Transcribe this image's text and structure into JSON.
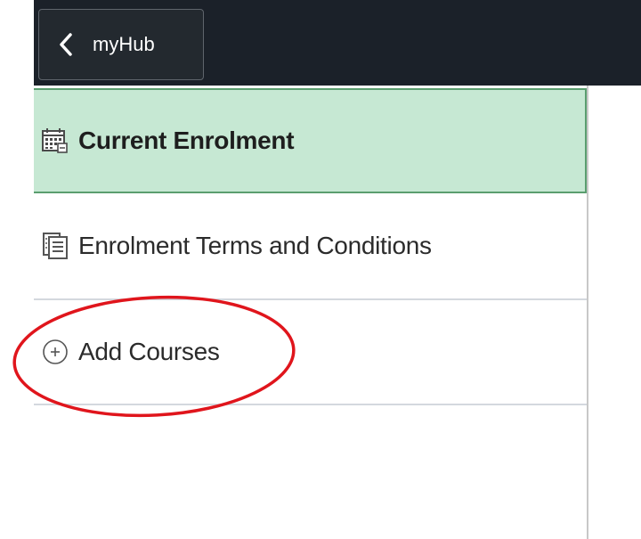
{
  "header": {
    "back_label": "myHub"
  },
  "nav": {
    "items": [
      {
        "label": "Current Enrolment",
        "icon": "calendar-icon",
        "active": true
      },
      {
        "label": "Enrolment Terms and Conditions",
        "icon": "document-icon",
        "active": false
      },
      {
        "label": "Add Courses",
        "icon": "add-circle-icon",
        "active": false
      }
    ]
  },
  "colors": {
    "topbar": "#1b2129",
    "active_item_bg": "#c6e8d3",
    "active_item_border": "#5a9e6f",
    "annotation": "#e0151c"
  }
}
